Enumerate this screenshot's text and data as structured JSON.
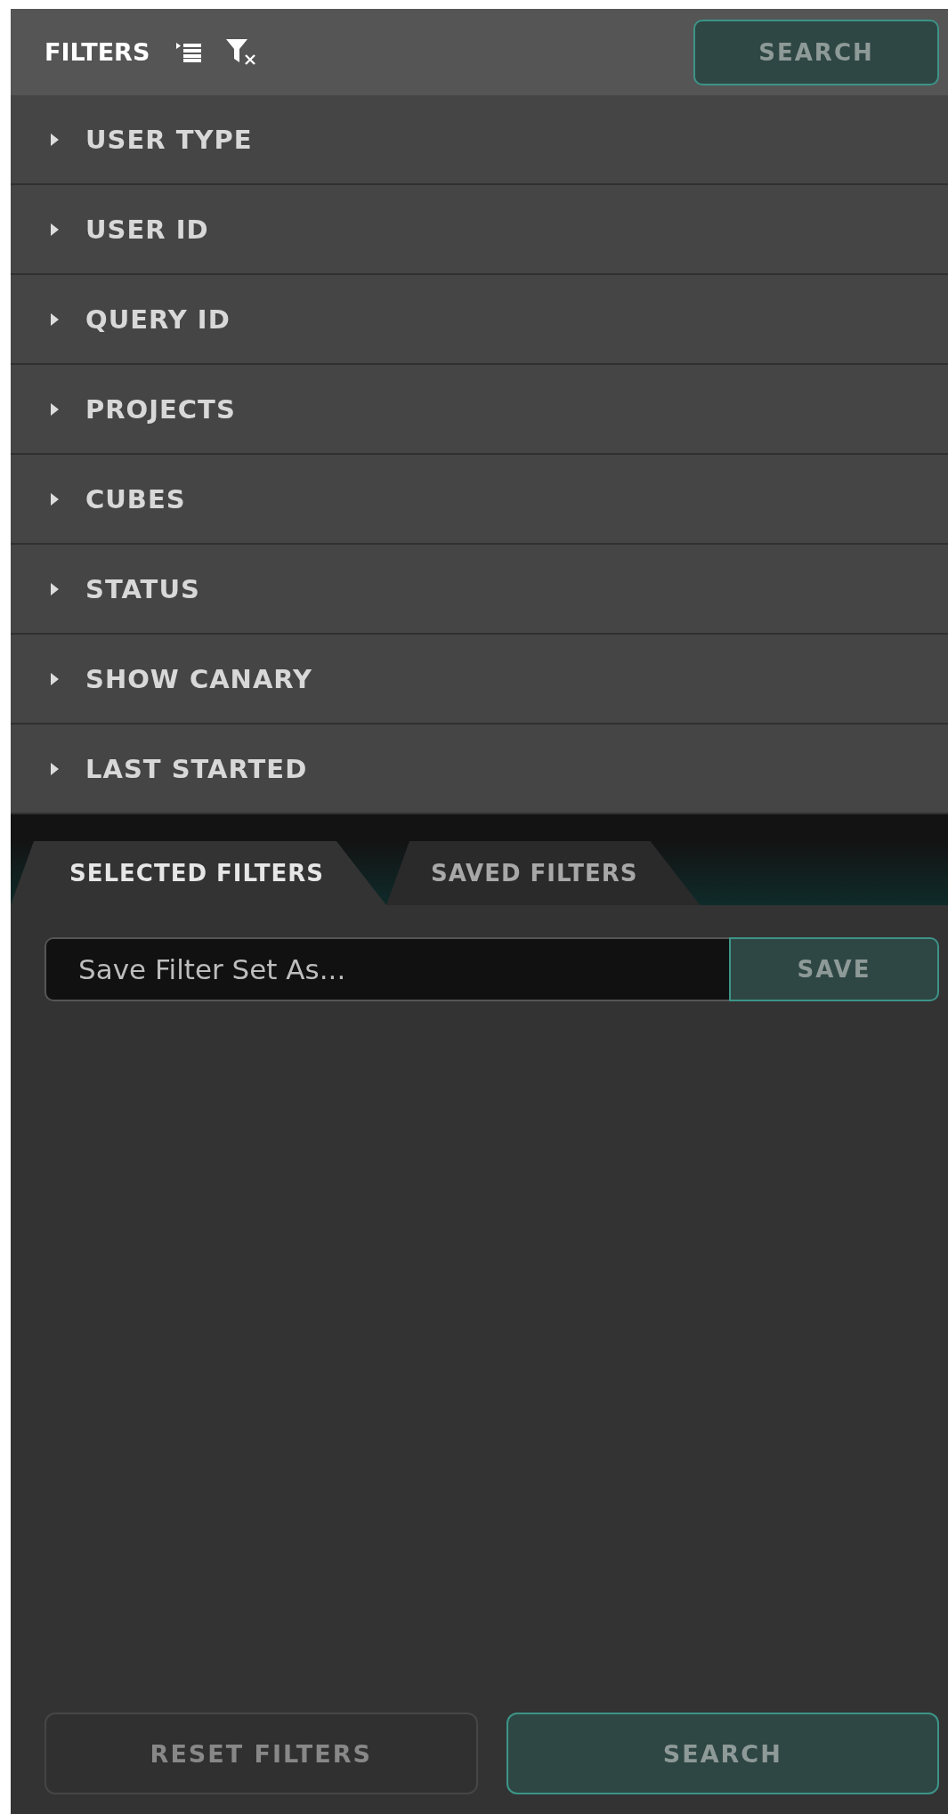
{
  "header": {
    "title": "FILTERS",
    "search_button": "SEARCH"
  },
  "filter_groups": [
    {
      "label": "USER TYPE",
      "expanded": false
    },
    {
      "label": "USER ID",
      "expanded": false
    },
    {
      "label": "QUERY ID",
      "expanded": false
    },
    {
      "label": "PROJECTS",
      "expanded": false
    },
    {
      "label": "CUBES",
      "expanded": false
    },
    {
      "label": "STATUS",
      "expanded": false
    },
    {
      "label": "SHOW CANARY",
      "expanded": false
    },
    {
      "label": "LAST STARTED",
      "expanded": false
    }
  ],
  "tabs": [
    {
      "label": "SELECTED FILTERS",
      "selected": true
    },
    {
      "label": "SAVED FILTERS",
      "selected": false
    }
  ],
  "save_field": {
    "placeholder": "Save Filter Set As...",
    "button": "SAVE"
  },
  "footer": {
    "reset_button": "RESET FILTERS",
    "search_button": "SEARCH"
  }
}
